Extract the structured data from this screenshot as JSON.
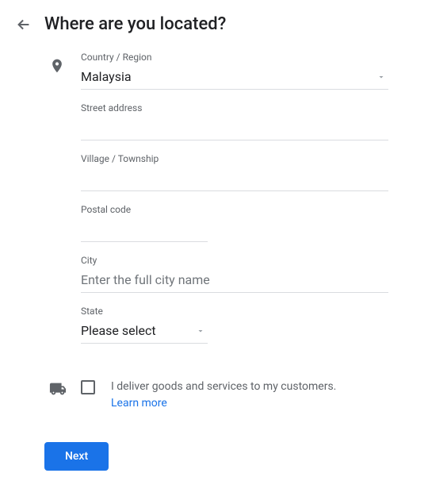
{
  "header": {
    "title": "Where are you located?"
  },
  "fields": {
    "country": {
      "label": "Country / Region",
      "value": "Malaysia"
    },
    "street": {
      "label": "Street address",
      "value": ""
    },
    "village": {
      "label": "Village / Township",
      "value": ""
    },
    "postal": {
      "label": "Postal code",
      "value": ""
    },
    "city": {
      "label": "City",
      "placeholder": "Enter the full city name",
      "value": ""
    },
    "state": {
      "label": "State",
      "value": "Please select"
    }
  },
  "deliver": {
    "text": "I deliver goods and services to my customers.",
    "learn_more": "Learn more"
  },
  "buttons": {
    "next": "Next"
  }
}
